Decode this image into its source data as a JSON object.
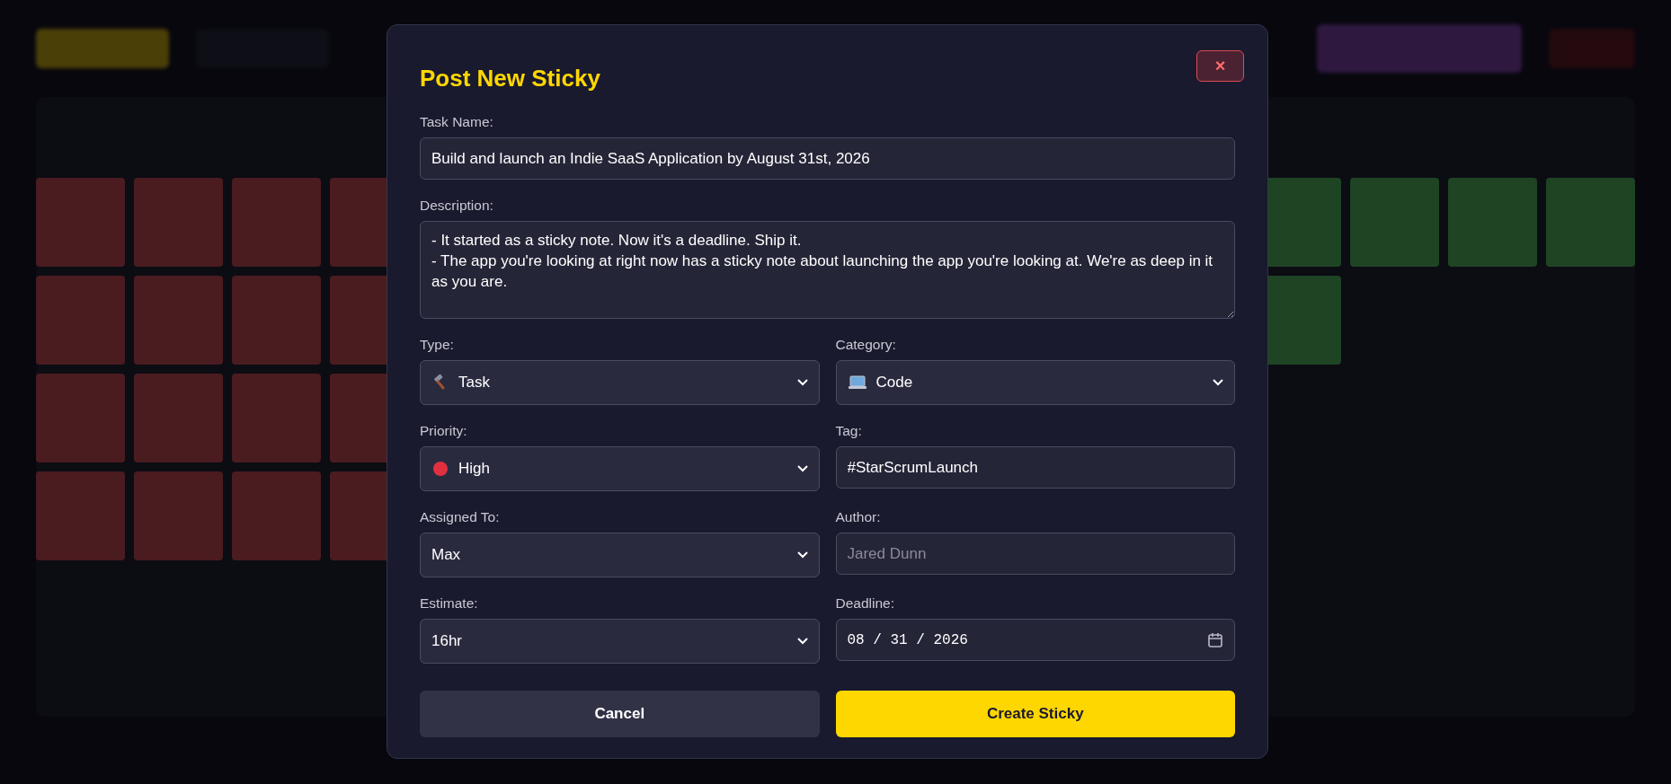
{
  "board": {
    "columns": [
      {
        "color": "#4a1c20"
      },
      {
        "color": "#1e4424"
      }
    ]
  },
  "dialog": {
    "title": "Post New Sticky",
    "close": "×",
    "fields": [
      {
        "kind": "text",
        "label": "Task Name:",
        "value": "Build and launch an Indie SaaS Application by August 31st, 2026"
      },
      {
        "kind": "textarea",
        "label": "Description:",
        "value": "- It started as a sticky note. Now it's a deadline. Ship it.\n- The app you're looking at right now has a sticky note about launching the app you're looking at. We're as deep in it as you are."
      },
      {
        "kind": "select",
        "label": "Type:",
        "value": "Task"
      },
      {
        "kind": "select",
        "label": "Category:",
        "value": "Code"
      },
      {
        "kind": "select",
        "label": "Priority:",
        "value": "High"
      },
      {
        "kind": "text",
        "label": "Tag:",
        "value": "#StarScrumLaunch"
      },
      {
        "kind": "select",
        "label": "Assigned To:",
        "value": "Max"
      },
      {
        "kind": "text",
        "label": "Author:",
        "placeholder": "Jared Dunn"
      },
      {
        "kind": "select",
        "label": "Estimate:",
        "value": "16hr"
      },
      {
        "kind": "date",
        "label": "Deadline:",
        "value": "08 / 31 / 2026"
      }
    ],
    "buttons": [
      {
        "kind": "secondary",
        "label": "Cancel"
      },
      {
        "kind": "primary",
        "label": "Create Sticky"
      }
    ]
  }
}
